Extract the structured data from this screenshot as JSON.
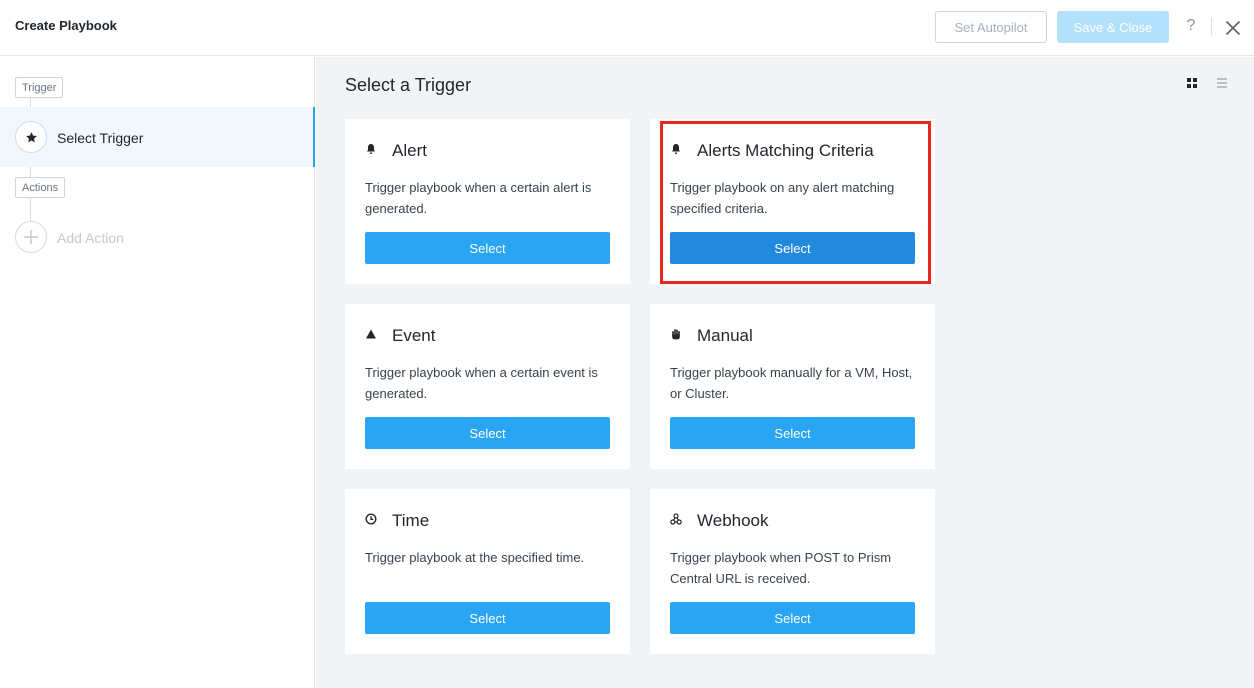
{
  "header": {
    "title": "Create Playbook",
    "set_autopilot_label": "Set Autopilot",
    "save_close_label": "Save & Close",
    "help_label": "?"
  },
  "sidebar": {
    "trigger_tag": "Trigger",
    "step_label": "Select Trigger",
    "actions_tag": "Actions",
    "add_action_label": "Add Action"
  },
  "main": {
    "title": "Select a Trigger",
    "cards": [
      {
        "icon": "bell-icon",
        "title": "Alert",
        "description": "Trigger playbook when a certain alert is generated.",
        "button": "Select"
      },
      {
        "icon": "bell-icon",
        "title": "Alerts Matching Criteria",
        "description": "Trigger playbook on any alert matching specified criteria.",
        "button": "Select"
      },
      {
        "icon": "triangle-icon",
        "title": "Event",
        "description": "Trigger playbook when a certain event is generated.",
        "button": "Select"
      },
      {
        "icon": "hand-icon",
        "title": "Manual",
        "description": "Trigger playbook manually for a VM, Host, or Cluster.",
        "button": "Select"
      },
      {
        "icon": "clock-icon",
        "title": "Time",
        "description": "Trigger playbook at the specified time.",
        "button": "Select"
      },
      {
        "icon": "webhook-icon",
        "title": "Webhook",
        "description": "Trigger playbook when POST to Prism Central URL is received.",
        "button": "Select"
      }
    ]
  },
  "colors": {
    "accent": "#29a5f3",
    "accent_active": "#2389dc",
    "highlight": "#e8261b"
  }
}
